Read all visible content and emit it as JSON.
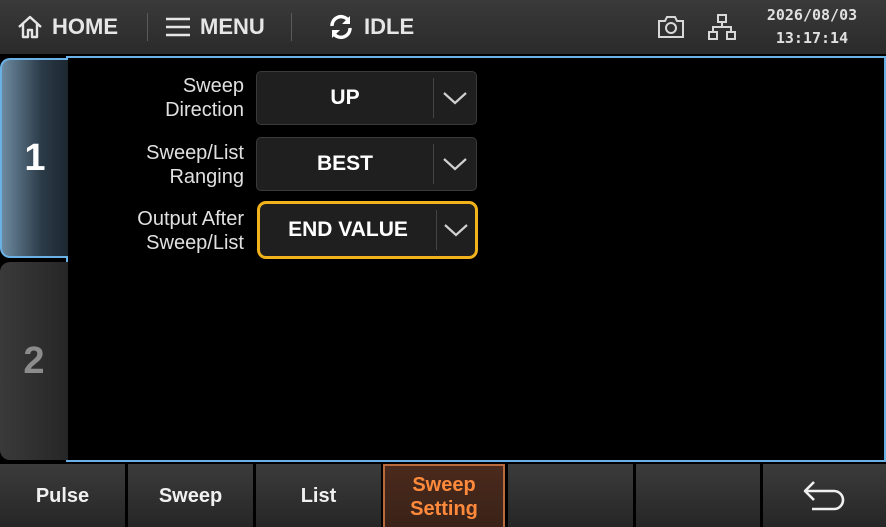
{
  "topbar": {
    "home_label": "HOME",
    "menu_label": "MENU",
    "status_label": "IDLE",
    "date": "2026/08/03",
    "time": "13:17:14"
  },
  "tabs": [
    {
      "label": "1",
      "active": true
    },
    {
      "label": "2",
      "active": false
    }
  ],
  "settings": {
    "sweep_direction": {
      "label_line1": "Sweep",
      "label_line2": "Direction",
      "value": "UP"
    },
    "ranging": {
      "label_line1": "Sweep/List",
      "label_line2": "Ranging",
      "value": "BEST"
    },
    "output_after": {
      "label_line1": "Output After",
      "label_line2": "Sweep/List",
      "value": "END VALUE"
    }
  },
  "softkeys": {
    "pulse": "Pulse",
    "sweep": "Sweep",
    "list": "List",
    "sweep_setting_line1": "Sweep",
    "sweep_setting_line2": "Setting"
  },
  "colors": {
    "accent_blue": "#6ab2e6",
    "focus_yellow": "#f2b21c",
    "active_orange": "#ff8a3c"
  }
}
